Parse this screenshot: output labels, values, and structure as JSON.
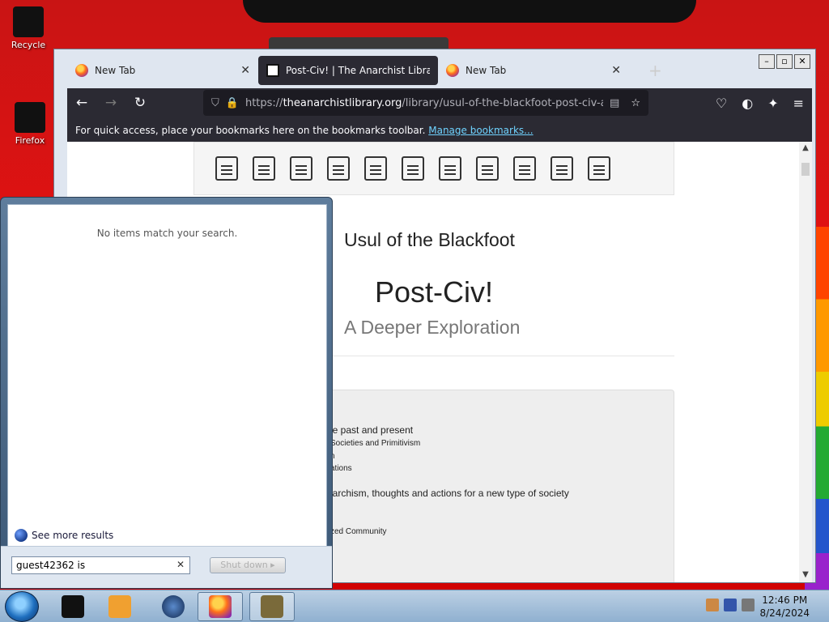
{
  "desktop": {
    "icons": [
      {
        "label": "Recycle",
        "name": "recycle-bin-icon"
      },
      {
        "label": "Firefox",
        "name": "firefox-desktop-icon"
      }
    ]
  },
  "browser": {
    "tabs": [
      {
        "label": "New Tab",
        "active": false
      },
      {
        "label": "Post-Civ! | The Anarchist Library",
        "active": true
      },
      {
        "label": "New Tab",
        "active": false
      }
    ],
    "url_prefix": "https://",
    "url_domain": "theanarchistlibrary.org",
    "url_path": "/library/usul-of-the-blackfoot-post-civ-a",
    "bookmarks_message": "For quick access, place your bookmarks here on the bookmarks toolbar.",
    "bookmarks_link": "Manage bookmarks..."
  },
  "page": {
    "author": "Usul of the Blackfoot",
    "title": "Post-Civ!",
    "subtitle": "A Deeper Exploration",
    "toc_fragments": [
      "he past and present",
      "Societies and Primitivism",
      "n",
      "ations",
      "narchism, thoughts and actions for a new type of society",
      "zed Community"
    ]
  },
  "start_menu": {
    "no_items": "No items match your search.",
    "see_more": "See more results",
    "search_value": "guest42362 is",
    "shutdown_label": "Shut down"
  },
  "taskbar": {
    "time": "12:46 PM",
    "date": "8/24/2024"
  }
}
